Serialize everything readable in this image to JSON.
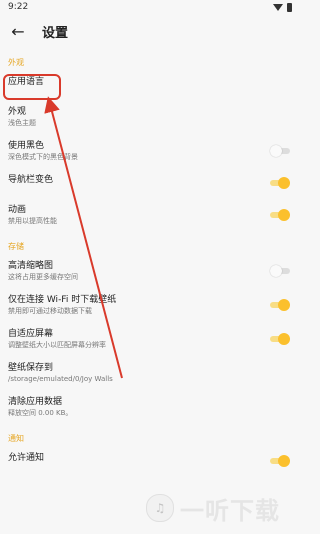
{
  "status": {
    "time": "9:22"
  },
  "header": {
    "title": "设置"
  },
  "sections": {
    "appearance": "外观",
    "storage": "存储",
    "notification": "通知"
  },
  "items": {
    "app_language": {
      "label": "应用语言"
    },
    "appearance": {
      "label": "外观",
      "sub": "浅色主题"
    },
    "use_black": {
      "label": "使用黑色",
      "sub": "深色模式下的黑色背景",
      "on": false
    },
    "navbar_color": {
      "label": "导航栏变色",
      "on": true
    },
    "animation": {
      "label": "动画",
      "sub": "禁用以提高性能",
      "on": true
    },
    "hd_thumbnail": {
      "label": "高清缩略图",
      "sub": "这将占用更多缓存空间",
      "on": false
    },
    "wifi_download": {
      "label": "仅在连接 Wi-Fi 时下载壁纸",
      "sub": "禁用即可通过移动数据下载",
      "on": true
    },
    "adaptive_screen": {
      "label": "自适应屏幕",
      "sub": "调整壁纸大小以匹配屏幕分辨率",
      "on": true
    },
    "wallpaper_path": {
      "label": "壁纸保存到",
      "sub": "/storage/emulated/0/Joy Walls"
    },
    "clear_data": {
      "label": "清除应用数据",
      "sub": "释放空间 0.00 KB。"
    },
    "allow_notify": {
      "label": "允许通知",
      "on": true
    }
  },
  "watermark": {
    "text": "一听下载"
  },
  "colors": {
    "accent": "#e6a623",
    "switch_on": "#fbc02d",
    "annotation": "#d93a2b"
  },
  "icons": [
    "back-arrow-icon",
    "wifi-icon",
    "battery-icon",
    "watermark-logo-icon"
  ]
}
